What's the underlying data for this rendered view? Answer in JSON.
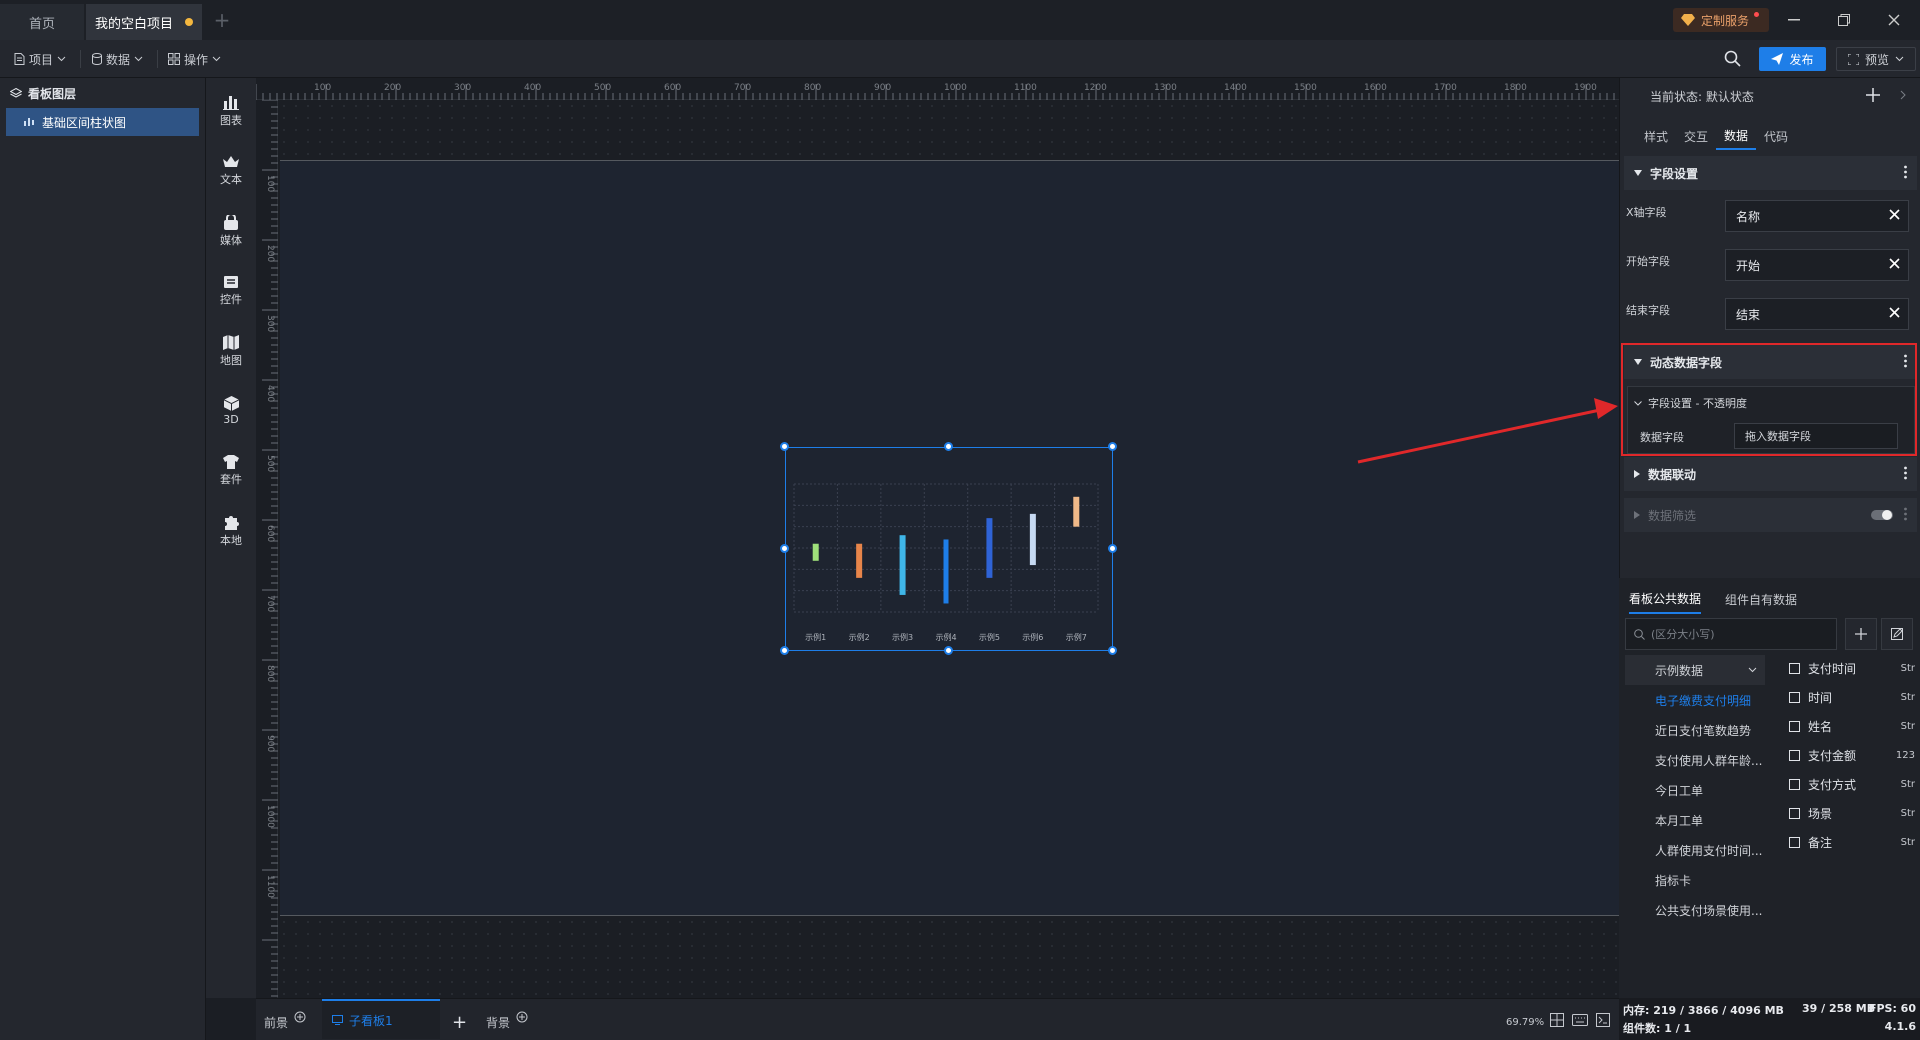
{
  "tabs": {
    "home": "首页",
    "project": "我的空白项目",
    "add": "+"
  },
  "custom_service": "定制服务",
  "menu": {
    "project": "项目",
    "data": "数据",
    "ops": "操作"
  },
  "toolbar": {
    "publish": "发布",
    "preview": "预览"
  },
  "layers": {
    "title": "看板图层",
    "items": [
      {
        "label": "基础区间柱状图"
      }
    ]
  },
  "components": [
    {
      "label": "图表",
      "icon": "bar-chart-icon"
    },
    {
      "label": "文本",
      "icon": "text-icon"
    },
    {
      "label": "媒体",
      "icon": "media-icon"
    },
    {
      "label": "控件",
      "icon": "control-icon"
    },
    {
      "label": "地图",
      "icon": "map-icon"
    },
    {
      "label": "3D",
      "icon": "cube-icon"
    },
    {
      "label": "套件",
      "icon": "suite-icon"
    },
    {
      "label": "本地",
      "icon": "puzzle-icon"
    }
  ],
  "ruler": {
    "x_ticks": [
      "100",
      "200",
      "300",
      "400",
      "500",
      "600",
      "700",
      "800",
      "900",
      "1000",
      "1100",
      "1200",
      "1300",
      "1400",
      "1500",
      "1600",
      "1700",
      "1800",
      "1900"
    ],
    "y_ticks": [
      "100",
      "200",
      "300",
      "400",
      "500",
      "600",
      "700",
      "800",
      "900",
      "1000",
      "1100"
    ]
  },
  "chart_data": {
    "type": "bar",
    "categories": [
      "示例1",
      "示例2",
      "示例3",
      "示例4",
      "示例5",
      "示例6",
      "示例7"
    ],
    "ranges": [
      [
        52,
        56
      ],
      [
        48,
        56
      ],
      [
        44,
        58
      ],
      [
        42,
        57
      ],
      [
        48,
        62
      ],
      [
        51,
        63
      ],
      [
        60,
        67
      ]
    ],
    "colors": [
      "#9fe07a",
      "#e8854a",
      "#3fb6e8",
      "#1e7ee8",
      "#2f63d6",
      "#c6d9f2",
      "#f0b989"
    ]
  },
  "bottom": {
    "foreground": "前景",
    "subboard": "子看板1",
    "add": "+",
    "background": "背景",
    "zoom": "69.79%"
  },
  "right": {
    "state_label": "当前状态:",
    "state_value": "默认状态",
    "tabs": [
      "样式",
      "交互",
      "数据",
      "代码"
    ],
    "field_section": "字段设置",
    "fields": [
      {
        "label": "X轴字段",
        "value": "名称"
      },
      {
        "label": "开始字段",
        "value": "开始"
      },
      {
        "label": "结束字段",
        "value": "结束"
      }
    ],
    "dynamic_section": "动态数据字段",
    "dynamic_sub": "字段设置 - 不透明度",
    "dynamic_field_label": "数据字段",
    "dynamic_field_placeholder": "拖入数据字段",
    "linkage_section": "数据联动",
    "filter_section": "数据筛选"
  },
  "data_panel": {
    "tabs": [
      "看板公共数据",
      "组件自有数据"
    ],
    "search_placeholder": "(区分大小写)",
    "sources": [
      "示例数据",
      "电子缴费支付明细",
      "近日支付笔数趋势",
      "支付使用人群年龄...",
      "今日工单",
      "本月工单",
      "人群使用支付时间...",
      "指标卡",
      "公共支付场景使用..."
    ],
    "fields": [
      {
        "name": "支付时间",
        "type": "Str"
      },
      {
        "name": "时间",
        "type": "Str"
      },
      {
        "name": "姓名",
        "type": "Str"
      },
      {
        "name": "支付金额",
        "type": "123"
      },
      {
        "name": "支付方式",
        "type": "Str"
      },
      {
        "name": "场景",
        "type": "Str"
      },
      {
        "name": "备注",
        "type": "Str"
      }
    ]
  },
  "status": {
    "memory": "内存: 219 / 3866 / 4096 MB",
    "mem2": "39 / 258 MB",
    "fps": "FPS: 60",
    "components": "组件数: 1 / 1",
    "version": "4.1.6"
  }
}
